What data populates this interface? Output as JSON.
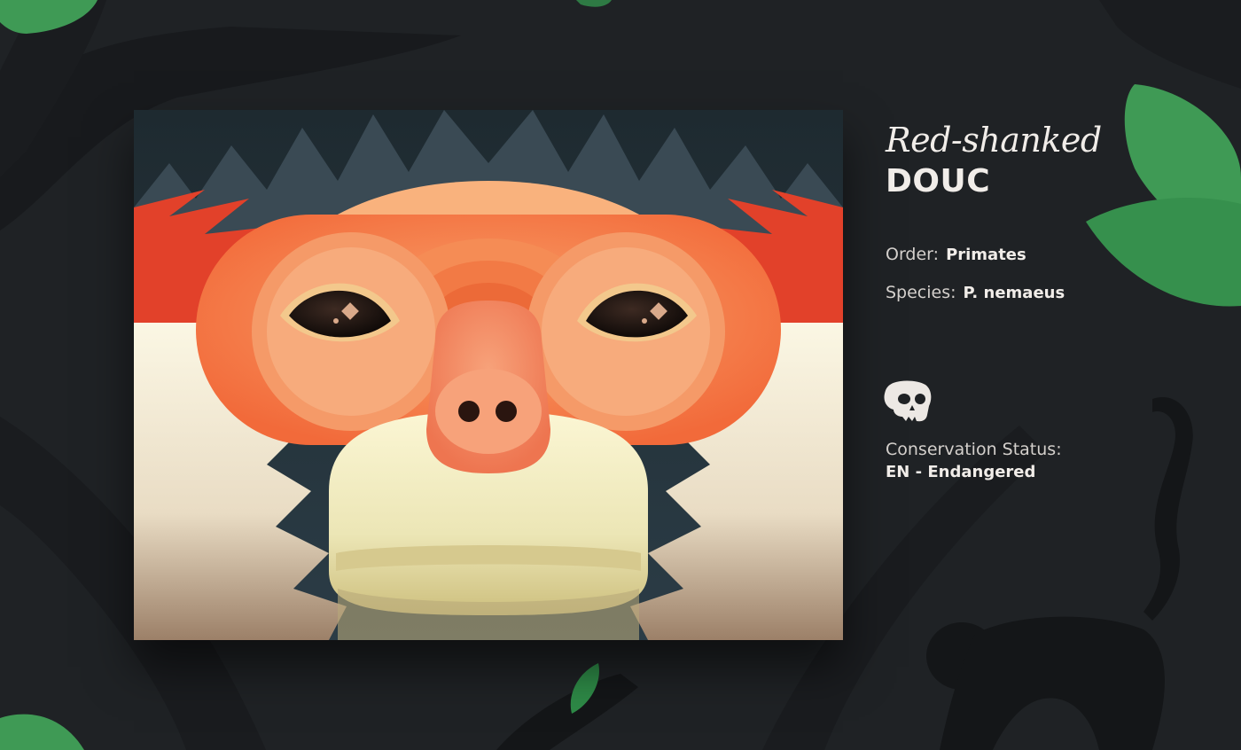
{
  "colors": {
    "background": "#1f2225",
    "leaf_green": "#3f9a55",
    "fur_orange": "#f26a3a",
    "fur_red": "#e2412a",
    "fur_cream": "#f4efd6",
    "hair_dark": "#3a4a54"
  },
  "icons": {
    "status": "skull-icon"
  },
  "species_card": {
    "common_name_script": "Red-shanked",
    "common_name_main": "DOUC",
    "order_label": "Order:",
    "order_value": "Primates",
    "species_label": "Species:",
    "species_value": "P. nemaeus",
    "status_label": "Conservation Status:",
    "status_value": "EN - Endangered"
  }
}
